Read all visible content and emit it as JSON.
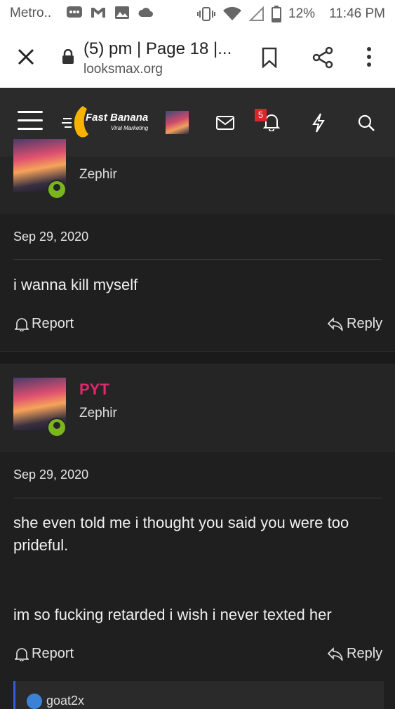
{
  "status_bar": {
    "carrier": "Metro..",
    "battery": "12%",
    "time": "11:46 PM"
  },
  "browser": {
    "title": "(5) pm | Page 18 |...",
    "url": "looksmax.org"
  },
  "site_header": {
    "logo_name": "Fast Banana",
    "logo_tagline": "Viral Marketing",
    "notification_count": "5"
  },
  "posts": [
    {
      "user_title": "Zephir",
      "date": "Sep 29, 2020",
      "message": "i wanna kill myself",
      "report_label": "Report",
      "reply_label": "Reply"
    },
    {
      "username": "PYT",
      "user_title": "Zephir",
      "date": "Sep 29, 2020",
      "message_line1": "she even told me i thought you said you were too prideful.",
      "message_line2": "im so fucking retarded i wish i never texted her",
      "report_label": "Report",
      "reply_label": "Reply"
    }
  ],
  "next_quote": {
    "name": "goat2x"
  },
  "colors": {
    "accent_username": "#e0286b",
    "online": "#79b51c",
    "badge": "#d9262a"
  }
}
